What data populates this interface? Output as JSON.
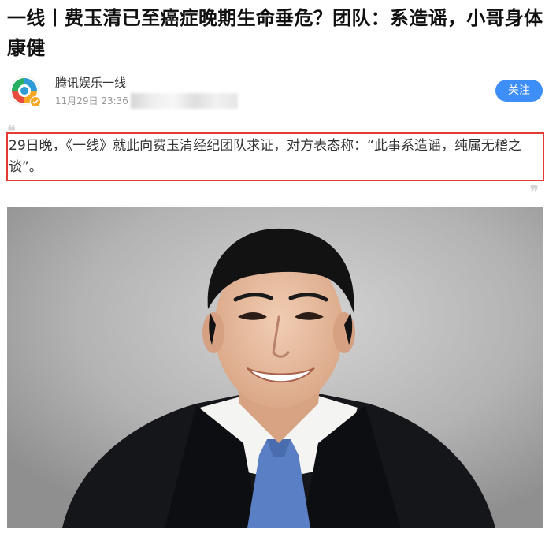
{
  "article": {
    "title": "一线丨费玉清已至癌症晚期生命垂危？团队：系造谣，小哥身体康健"
  },
  "author": {
    "name": "腾讯娱乐一线",
    "datetime": "11月29日 23:36",
    "avatar_icon": "tencent-news-logo-icon",
    "verified_icon": "verified-badge-icon",
    "follow_label": "关注",
    "follow_color": "#3e8ef7"
  },
  "quote": {
    "open_mark": "❝",
    "close_mark": "❞",
    "text": "29日晚，《一线》就此向费玉清经纪团队求证，对方表态称：“此事系造谣，纯属无稽之谈”。",
    "highlight_color": "#e53935"
  },
  "photo": {
    "subject_icon": "portrait-photo"
  }
}
